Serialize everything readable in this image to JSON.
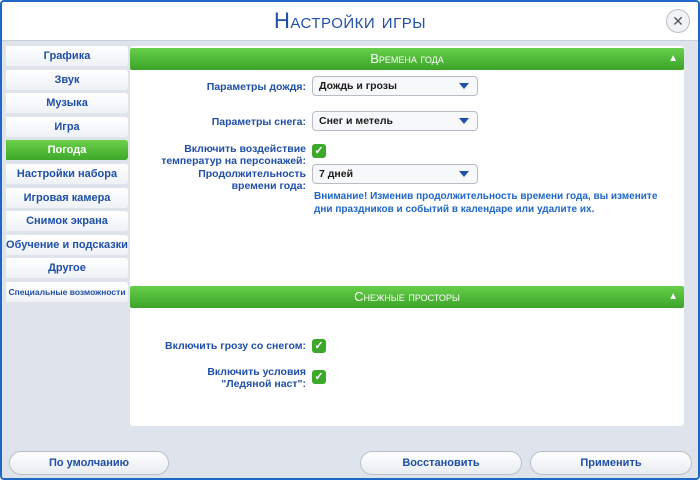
{
  "window": {
    "title": "Настройки игры"
  },
  "sidebar": {
    "items": [
      {
        "label": "Графика"
      },
      {
        "label": "Звук"
      },
      {
        "label": "Музыка"
      },
      {
        "label": "Игра"
      },
      {
        "label": "Погода"
      },
      {
        "label": "Настройки набора"
      },
      {
        "label": "Игровая камера"
      },
      {
        "label": "Снимок экрана"
      },
      {
        "label": "Обучение и подсказки"
      },
      {
        "label": "Другое"
      },
      {
        "label": "Специальные возможности"
      }
    ],
    "active": "Погода"
  },
  "seasons": {
    "header": "Времена года",
    "rain_label": "Параметры дождя:",
    "rain_value": "Дождь и грозы",
    "snow_label": "Параметры снега:",
    "snow_value": "Снег и метель",
    "temp_label_1": "Включить воздействие",
    "temp_label_2": "температур на персонажей:",
    "temp_checked": true,
    "duration_label_1": "Продолжительность",
    "duration_label_2": "времени года:",
    "duration_value": "7 дней",
    "notice": "Внимание! Изменив продолжительность времени года, вы измените дни праздников и событий в календаре или удалите их."
  },
  "snowy": {
    "header": "Снежные просторы",
    "thunder_label": "Включить грозу со снегом:",
    "thunder_checked": true,
    "ice_label_1": "Включить условия",
    "ice_label_2": "\"Ледяной наст\":",
    "ice_checked": true
  },
  "footer": {
    "default_label": "По умолчанию",
    "restore_label": "Восстановить",
    "apply_label": "Применить"
  },
  "icons": {
    "close": "close-icon",
    "collapse": "chevron-up-icon",
    "dropdown": "caret-down-icon",
    "check": "checkmark-icon"
  },
  "colors": {
    "accent_green": "#4cb834",
    "text_blue": "#1f4fa6",
    "border_blue": "#1f67c4"
  }
}
